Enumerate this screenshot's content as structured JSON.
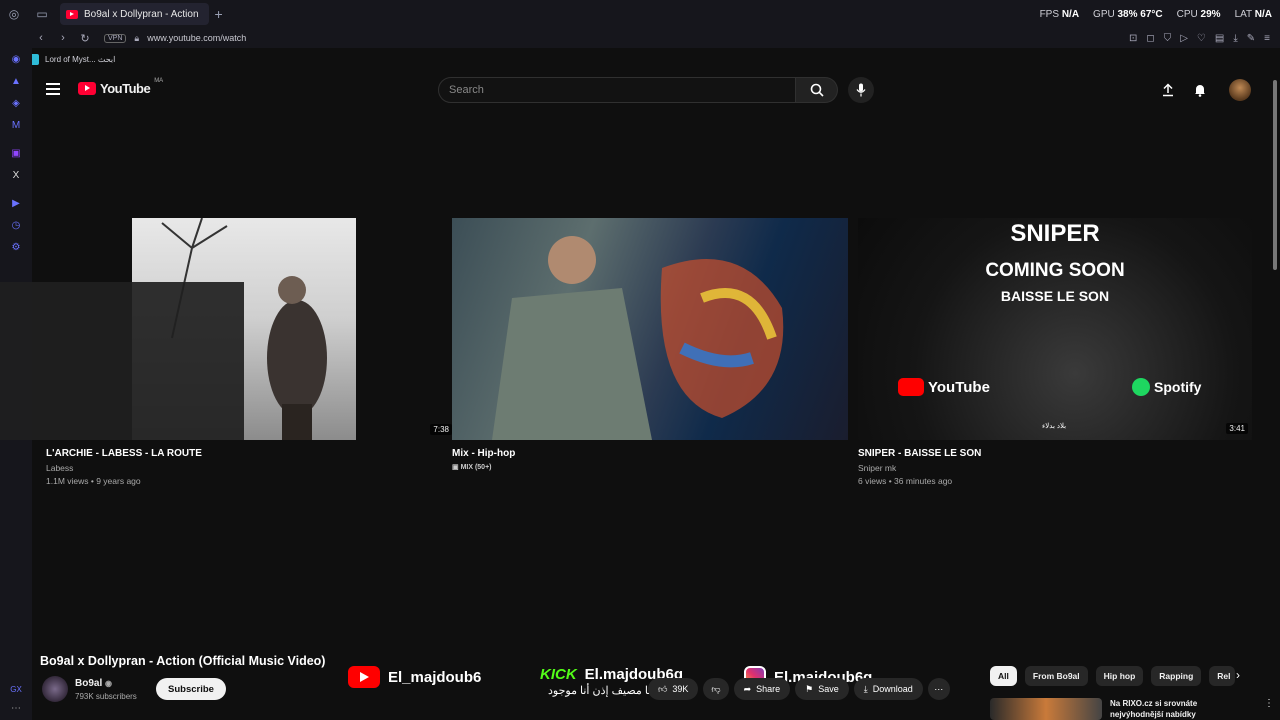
{
  "browser": {
    "tab_title": "Bo9al x Dollypran - Action",
    "new_tab": "+",
    "url": "www.youtube.com/watch",
    "vpn": "VPN",
    "bookmark": "Lord of Myst... ابحث",
    "stats": {
      "fps_label": "FPS",
      "fps_value": "N/A",
      "gpu_label": "GPU",
      "gpu_value": "38% 67°C",
      "cpu_label": "CPU",
      "cpu_value": "29%",
      "lat_label": "LAT",
      "lat_value": "N/A"
    }
  },
  "youtube": {
    "logo_text": "YouTube",
    "logo_country": "MA",
    "search_placeholder": "Search"
  },
  "end_cards": [
    {
      "title": "L'ARCHIE - LABESS - LA ROUTE",
      "channel": "Labess",
      "meta": "1.1M views • 9 years ago",
      "duration": "7:38"
    },
    {
      "title": "Mix - Hip-hop",
      "channel": "MIX (50+)",
      "meta": "",
      "duration": ""
    },
    {
      "title": "SNIPER - BAISSE LE SON",
      "channel": "Sniper mk",
      "meta": "6 views • 36 minutes ago",
      "duration": "3:41",
      "thumb_text": {
        "headline": "SNIPER",
        "line1": "COMING SOON",
        "line2": "BAISSE LE SON",
        "yt": "YouTube",
        "spotify": "Spotify",
        "arabic": "بلاد بدلاء"
      }
    }
  ],
  "video": {
    "title": "Bo9al x Dollypran - Action (Official Music Video)",
    "channel": "Bo9al",
    "subscribers": "793K subscribers",
    "subscribe_label": "Subscribe",
    "likes": "39K",
    "share_label": "Share",
    "save_label": "Save",
    "download_label": "Download"
  },
  "overlay_social": {
    "youtube_handle": "El_majdoub6",
    "kick_label": "KICK",
    "kick_handle": "El.majdoub6g",
    "instagram_handle": "El.majdoub6g",
    "arabic_line": "أنا مصيف إذن أنا موجود"
  },
  "chips": [
    "All",
    "From Bo9al",
    "Hip hop",
    "Rapping",
    "Rel"
  ],
  "side_item": {
    "title": "Na RIXO.cz si srovnáte nejvýhodnější nabídky"
  }
}
